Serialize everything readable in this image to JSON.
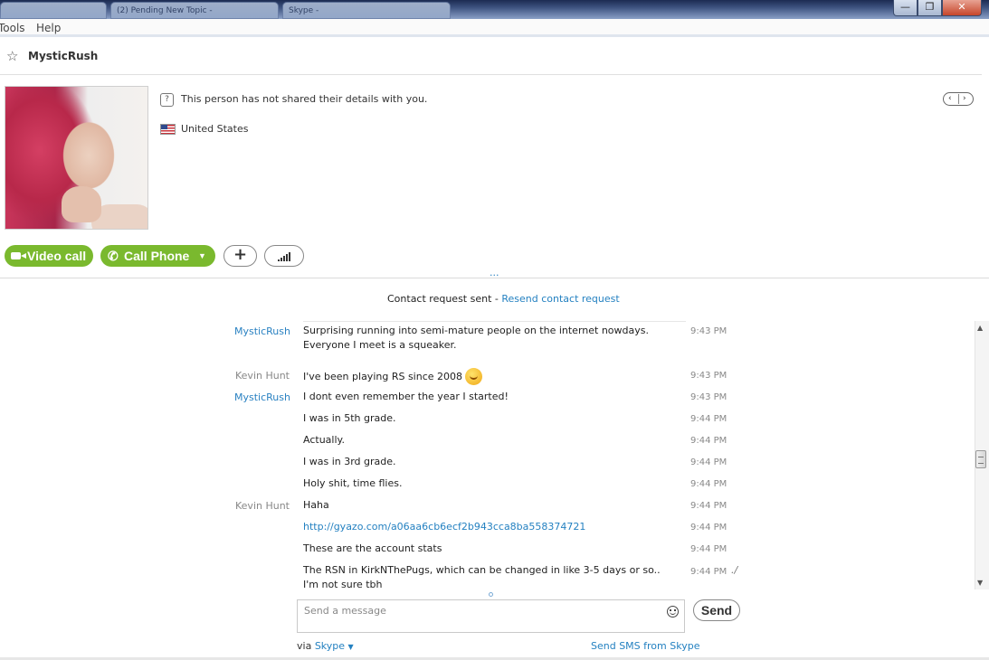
{
  "window": {
    "tabs": [
      "",
      "(2) Pending New Topic - ",
      "Skype - "
    ],
    "controls": {
      "minimize": "—",
      "maximize": "❐",
      "close": "✕"
    }
  },
  "menu": {
    "items": [
      "Tools",
      "Help"
    ]
  },
  "contact": {
    "name": "MysticRush",
    "details_text": "This person has not shared their details with you.",
    "country": "United States",
    "pager": {
      "prev": "‹",
      "next": "›"
    }
  },
  "actions": {
    "video_call": "Video call",
    "call_phone": "Call Phone",
    "add": "+"
  },
  "dots": "...",
  "chat": {
    "request_sent": "Contact request sent - ",
    "resend_link": "Resend contact request",
    "messages": [
      {
        "sender": "MysticRush",
        "text": "Surprising running into semi-mature people on the internet nowdays. Everyone I meet is a squeaker.",
        "time": "9:43 PM"
      },
      {
        "sender": "Kevin Hunt",
        "text": "I've been playing RS since 2008",
        "time": "9:43 PM"
      },
      {
        "sender": "MysticRush",
        "text": "I dont even remember the year I started!",
        "time": "9:43 PM"
      },
      {
        "sender": "",
        "text": "I was in 5th grade.",
        "time": "9:44 PM"
      },
      {
        "sender": "",
        "text": "Actually.",
        "time": "9:44 PM"
      },
      {
        "sender": "",
        "text": "I was in 3rd grade.",
        "time": "9:44 PM"
      },
      {
        "sender": "",
        "text": "Holy shit, time flies.",
        "time": "9:44 PM"
      },
      {
        "sender": "Kevin Hunt",
        "text": "Haha",
        "time": "9:44 PM"
      },
      {
        "sender": "",
        "text": "http://gyazo.com/a06aa6cb6ecf2b943cca8ba558374721",
        "time": "9:44 PM"
      },
      {
        "sender": "",
        "text": "These are the account stats",
        "time": "9:44 PM"
      },
      {
        "sender": "",
        "text": "The RSN in KirkNThePugs, which can be changed in like 3-5  days or so.. I'm not sure tbh",
        "time": "9:44 PM"
      }
    ],
    "typing_indicator": "./"
  },
  "composer": {
    "placeholder": "Send a message",
    "send_label": "Send",
    "via_prefix": "via ",
    "via_link": "Skype",
    "sms_link": "Send SMS from Skype"
  },
  "colors": {
    "accent_green": "#7ab92e",
    "link_blue": "#2481c1"
  }
}
